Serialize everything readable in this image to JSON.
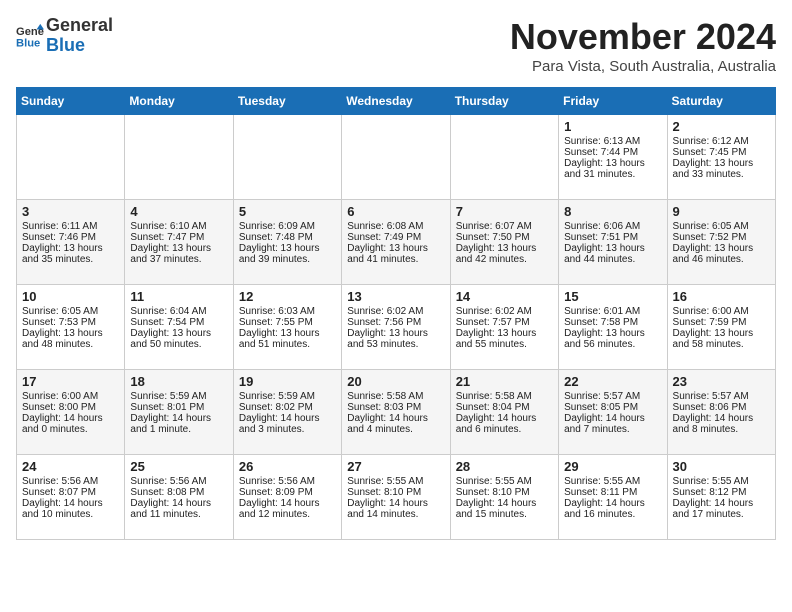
{
  "header": {
    "logo_line1": "General",
    "logo_line2": "Blue",
    "month": "November 2024",
    "location": "Para Vista, South Australia, Australia"
  },
  "days_of_week": [
    "Sunday",
    "Monday",
    "Tuesday",
    "Wednesday",
    "Thursday",
    "Friday",
    "Saturday"
  ],
  "weeks": [
    [
      {
        "day": "",
        "content": ""
      },
      {
        "day": "",
        "content": ""
      },
      {
        "day": "",
        "content": ""
      },
      {
        "day": "",
        "content": ""
      },
      {
        "day": "",
        "content": ""
      },
      {
        "day": "1",
        "content": "Sunrise: 6:13 AM\nSunset: 7:44 PM\nDaylight: 13 hours\nand 31 minutes."
      },
      {
        "day": "2",
        "content": "Sunrise: 6:12 AM\nSunset: 7:45 PM\nDaylight: 13 hours\nand 33 minutes."
      }
    ],
    [
      {
        "day": "3",
        "content": "Sunrise: 6:11 AM\nSunset: 7:46 PM\nDaylight: 13 hours\nand 35 minutes."
      },
      {
        "day": "4",
        "content": "Sunrise: 6:10 AM\nSunset: 7:47 PM\nDaylight: 13 hours\nand 37 minutes."
      },
      {
        "day": "5",
        "content": "Sunrise: 6:09 AM\nSunset: 7:48 PM\nDaylight: 13 hours\nand 39 minutes."
      },
      {
        "day": "6",
        "content": "Sunrise: 6:08 AM\nSunset: 7:49 PM\nDaylight: 13 hours\nand 41 minutes."
      },
      {
        "day": "7",
        "content": "Sunrise: 6:07 AM\nSunset: 7:50 PM\nDaylight: 13 hours\nand 42 minutes."
      },
      {
        "day": "8",
        "content": "Sunrise: 6:06 AM\nSunset: 7:51 PM\nDaylight: 13 hours\nand 44 minutes."
      },
      {
        "day": "9",
        "content": "Sunrise: 6:05 AM\nSunset: 7:52 PM\nDaylight: 13 hours\nand 46 minutes."
      }
    ],
    [
      {
        "day": "10",
        "content": "Sunrise: 6:05 AM\nSunset: 7:53 PM\nDaylight: 13 hours\nand 48 minutes."
      },
      {
        "day": "11",
        "content": "Sunrise: 6:04 AM\nSunset: 7:54 PM\nDaylight: 13 hours\nand 50 minutes."
      },
      {
        "day": "12",
        "content": "Sunrise: 6:03 AM\nSunset: 7:55 PM\nDaylight: 13 hours\nand 51 minutes."
      },
      {
        "day": "13",
        "content": "Sunrise: 6:02 AM\nSunset: 7:56 PM\nDaylight: 13 hours\nand 53 minutes."
      },
      {
        "day": "14",
        "content": "Sunrise: 6:02 AM\nSunset: 7:57 PM\nDaylight: 13 hours\nand 55 minutes."
      },
      {
        "day": "15",
        "content": "Sunrise: 6:01 AM\nSunset: 7:58 PM\nDaylight: 13 hours\nand 56 minutes."
      },
      {
        "day": "16",
        "content": "Sunrise: 6:00 AM\nSunset: 7:59 PM\nDaylight: 13 hours\nand 58 minutes."
      }
    ],
    [
      {
        "day": "17",
        "content": "Sunrise: 6:00 AM\nSunset: 8:00 PM\nDaylight: 14 hours\nand 0 minutes."
      },
      {
        "day": "18",
        "content": "Sunrise: 5:59 AM\nSunset: 8:01 PM\nDaylight: 14 hours\nand 1 minute."
      },
      {
        "day": "19",
        "content": "Sunrise: 5:59 AM\nSunset: 8:02 PM\nDaylight: 14 hours\nand 3 minutes."
      },
      {
        "day": "20",
        "content": "Sunrise: 5:58 AM\nSunset: 8:03 PM\nDaylight: 14 hours\nand 4 minutes."
      },
      {
        "day": "21",
        "content": "Sunrise: 5:58 AM\nSunset: 8:04 PM\nDaylight: 14 hours\nand 6 minutes."
      },
      {
        "day": "22",
        "content": "Sunrise: 5:57 AM\nSunset: 8:05 PM\nDaylight: 14 hours\nand 7 minutes."
      },
      {
        "day": "23",
        "content": "Sunrise: 5:57 AM\nSunset: 8:06 PM\nDaylight: 14 hours\nand 8 minutes."
      }
    ],
    [
      {
        "day": "24",
        "content": "Sunrise: 5:56 AM\nSunset: 8:07 PM\nDaylight: 14 hours\nand 10 minutes."
      },
      {
        "day": "25",
        "content": "Sunrise: 5:56 AM\nSunset: 8:08 PM\nDaylight: 14 hours\nand 11 minutes."
      },
      {
        "day": "26",
        "content": "Sunrise: 5:56 AM\nSunset: 8:09 PM\nDaylight: 14 hours\nand 12 minutes."
      },
      {
        "day": "27",
        "content": "Sunrise: 5:55 AM\nSunset: 8:10 PM\nDaylight: 14 hours\nand 14 minutes."
      },
      {
        "day": "28",
        "content": "Sunrise: 5:55 AM\nSunset: 8:10 PM\nDaylight: 14 hours\nand 15 minutes."
      },
      {
        "day": "29",
        "content": "Sunrise: 5:55 AM\nSunset: 8:11 PM\nDaylight: 14 hours\nand 16 minutes."
      },
      {
        "day": "30",
        "content": "Sunrise: 5:55 AM\nSunset: 8:12 PM\nDaylight: 14 hours\nand 17 minutes."
      }
    ]
  ]
}
